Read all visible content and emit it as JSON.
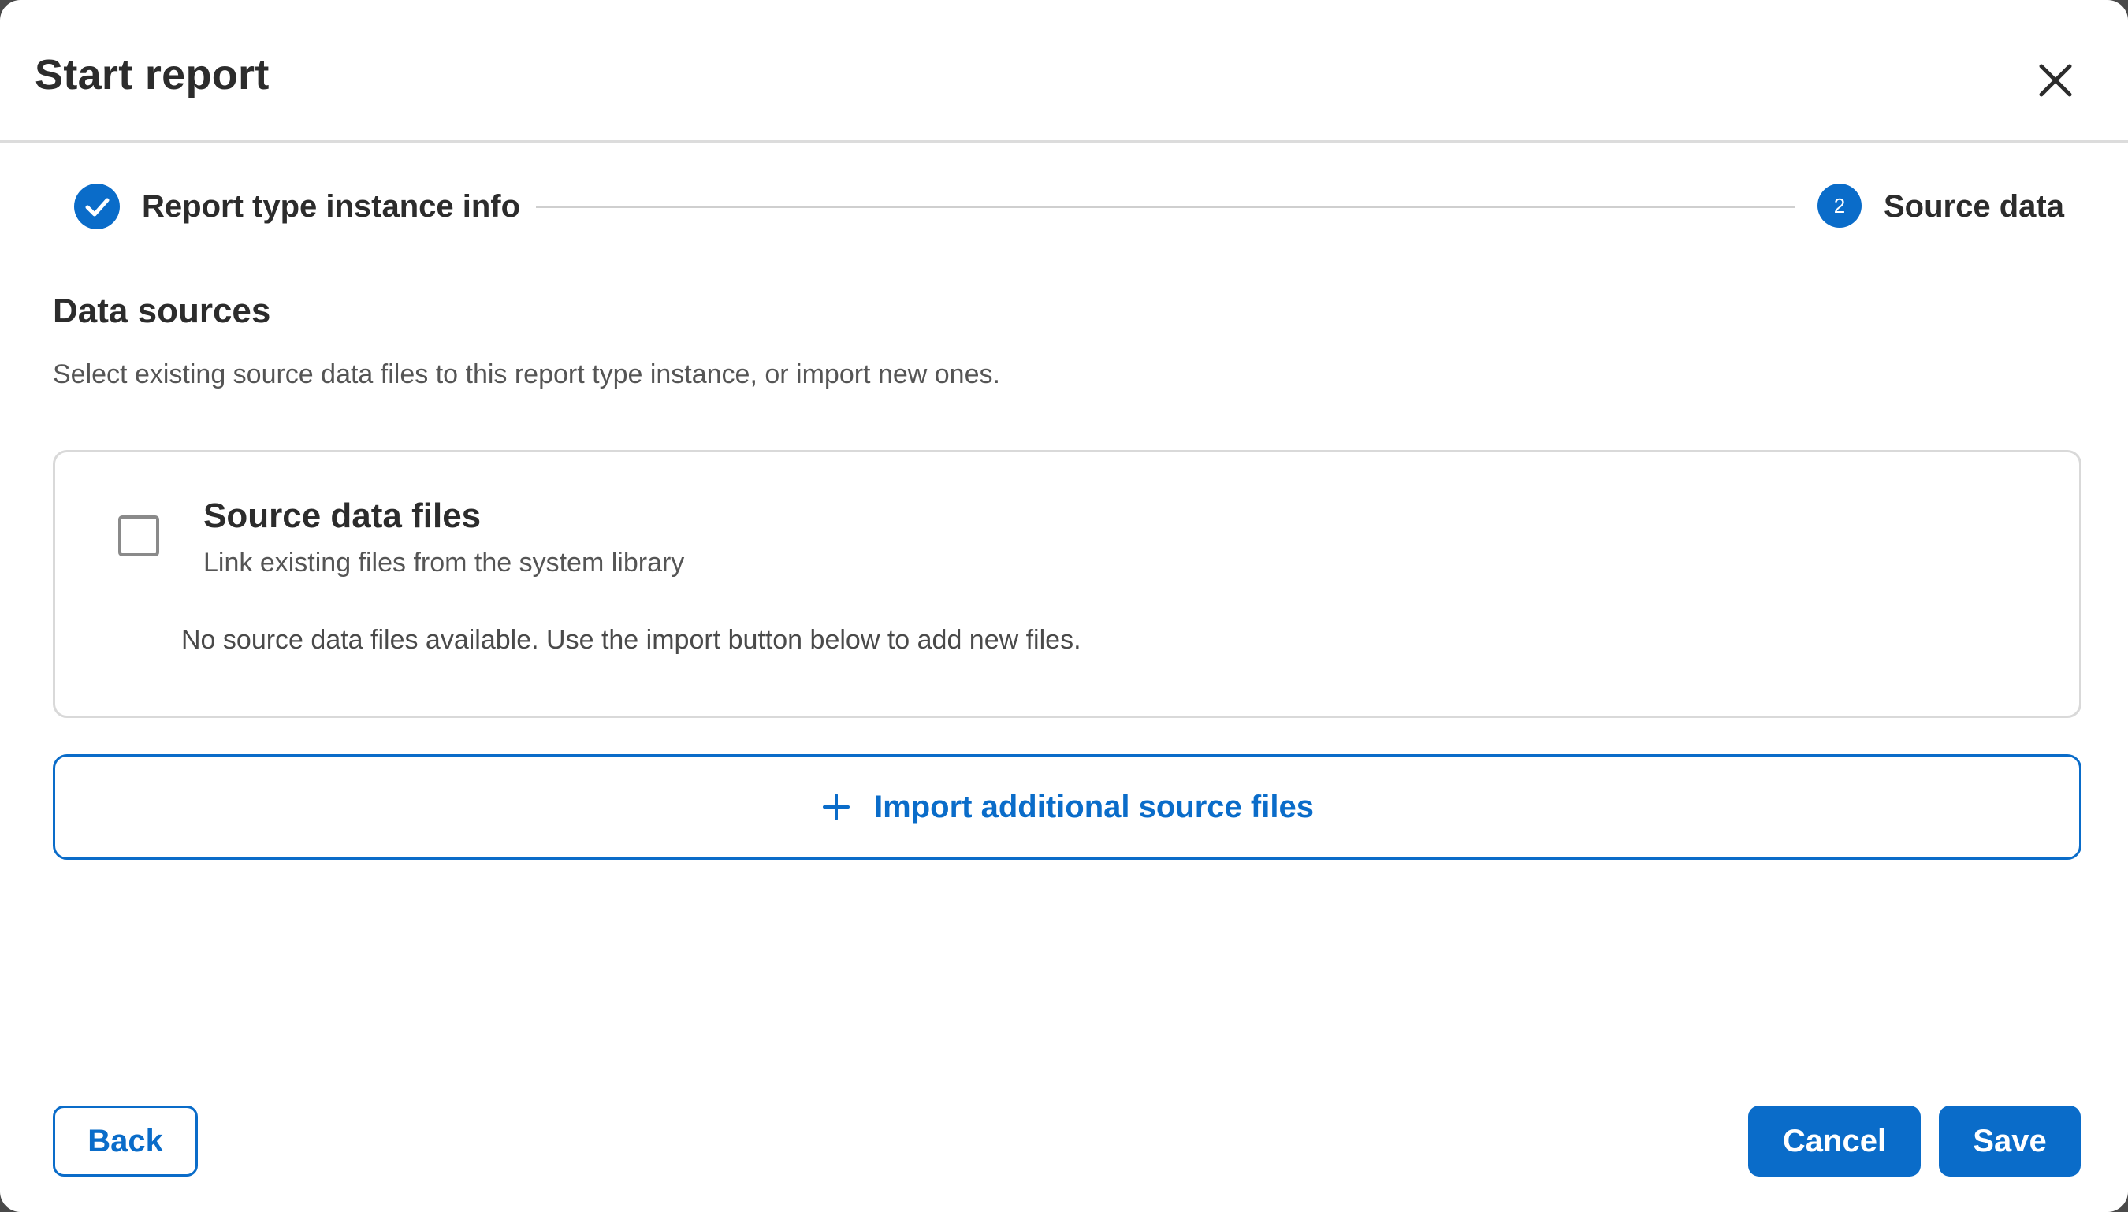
{
  "dialog": {
    "title": "Start report",
    "close_icon": "close-icon"
  },
  "stepper": {
    "steps": [
      {
        "label": "Report type instance info",
        "status": "completed",
        "icon": "check-icon"
      },
      {
        "label": "Source data",
        "status": "current",
        "number": "2"
      }
    ]
  },
  "section": {
    "title": "Data sources",
    "description": "Select existing source data files to this report type instance, or import new ones."
  },
  "source_card": {
    "checked": false,
    "title": "Source data files",
    "subtitle": "Link existing files from the system library",
    "empty_message": "No source data files available. Use the import button below to add new files."
  },
  "import_button": {
    "icon": "plus-icon",
    "label": "Import additional source files"
  },
  "footer": {
    "back_label": "Back",
    "cancel_label": "Cancel",
    "save_label": "Save"
  },
  "colors": {
    "accent": "#0a6cc9",
    "text": "#2c2c2c",
    "muted_text": "#555555",
    "border": "#d9d9d9"
  }
}
